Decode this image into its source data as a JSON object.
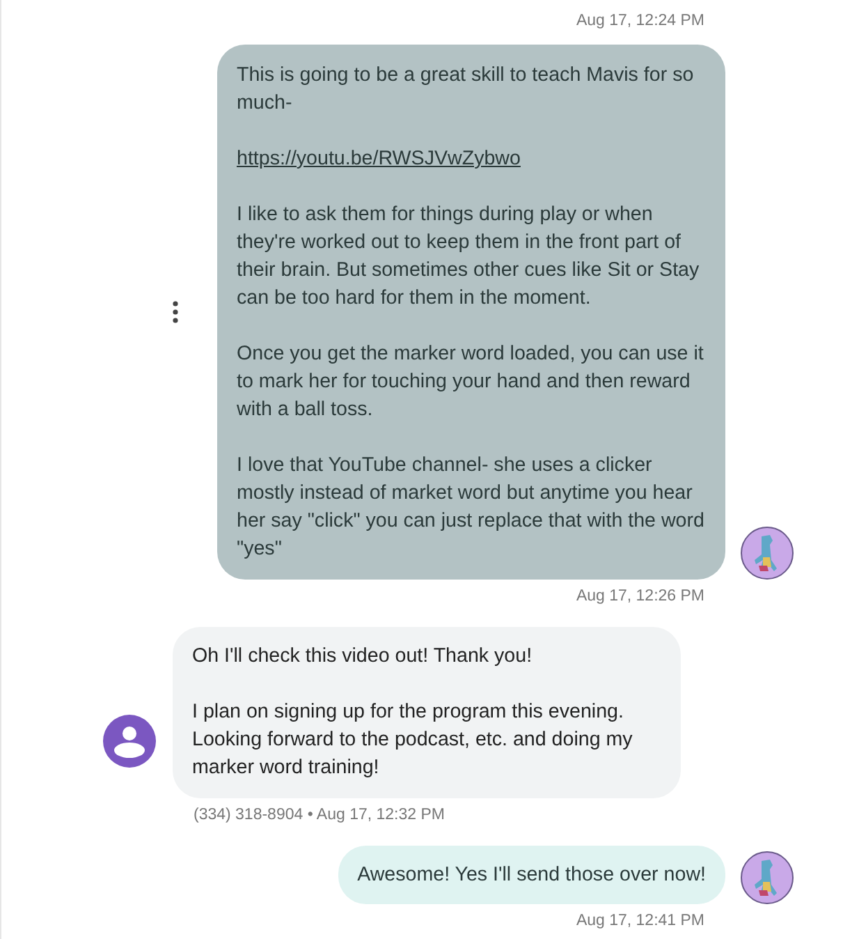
{
  "messages": [
    {
      "kind": "timestamp",
      "text": "Aug 17, 12:24 PM"
    },
    {
      "kind": "outgoing",
      "selected": true,
      "paragraphs": [
        {
          "kind": "text",
          "text": "This is going to be a great skill to teach Mavis for so much-"
        },
        {
          "kind": "link",
          "text": "https://youtu.be/RWSJVwZybwo"
        },
        {
          "kind": "text",
          "text": "I like to ask them for things during play or when they're worked out to keep them in the front part of their brain. But sometimes other cues like Sit or Stay can be too hard for them in the moment."
        },
        {
          "kind": "text",
          "text": "Once you get the marker word loaded, you can use it to mark her for touching your hand and then reward with a ball toss."
        },
        {
          "kind": "text",
          "text": "I love that YouTube channel- she uses a clicker mostly instead of market word but anytime you hear her say \"click\" you can just replace that with the word \"yes\""
        }
      ],
      "meta": "Aug 17, 12:26 PM"
    },
    {
      "kind": "incoming",
      "selected": false,
      "paragraphs": [
        {
          "kind": "text",
          "text": "Oh I'll check this video out! Thank you!"
        },
        {
          "kind": "text",
          "text": "I plan on signing up for the program this evening. Looking forward to the podcast, etc. and doing my marker word training!"
        }
      ],
      "meta": "(334) 318-8904 • Aug 17, 12:32 PM"
    },
    {
      "kind": "outgoing",
      "selected": false,
      "paragraphs": [
        {
          "kind": "text",
          "text": "Awesome! Yes I'll send those over now!"
        }
      ],
      "meta": "Aug 17, 12:41 PM"
    }
  ]
}
